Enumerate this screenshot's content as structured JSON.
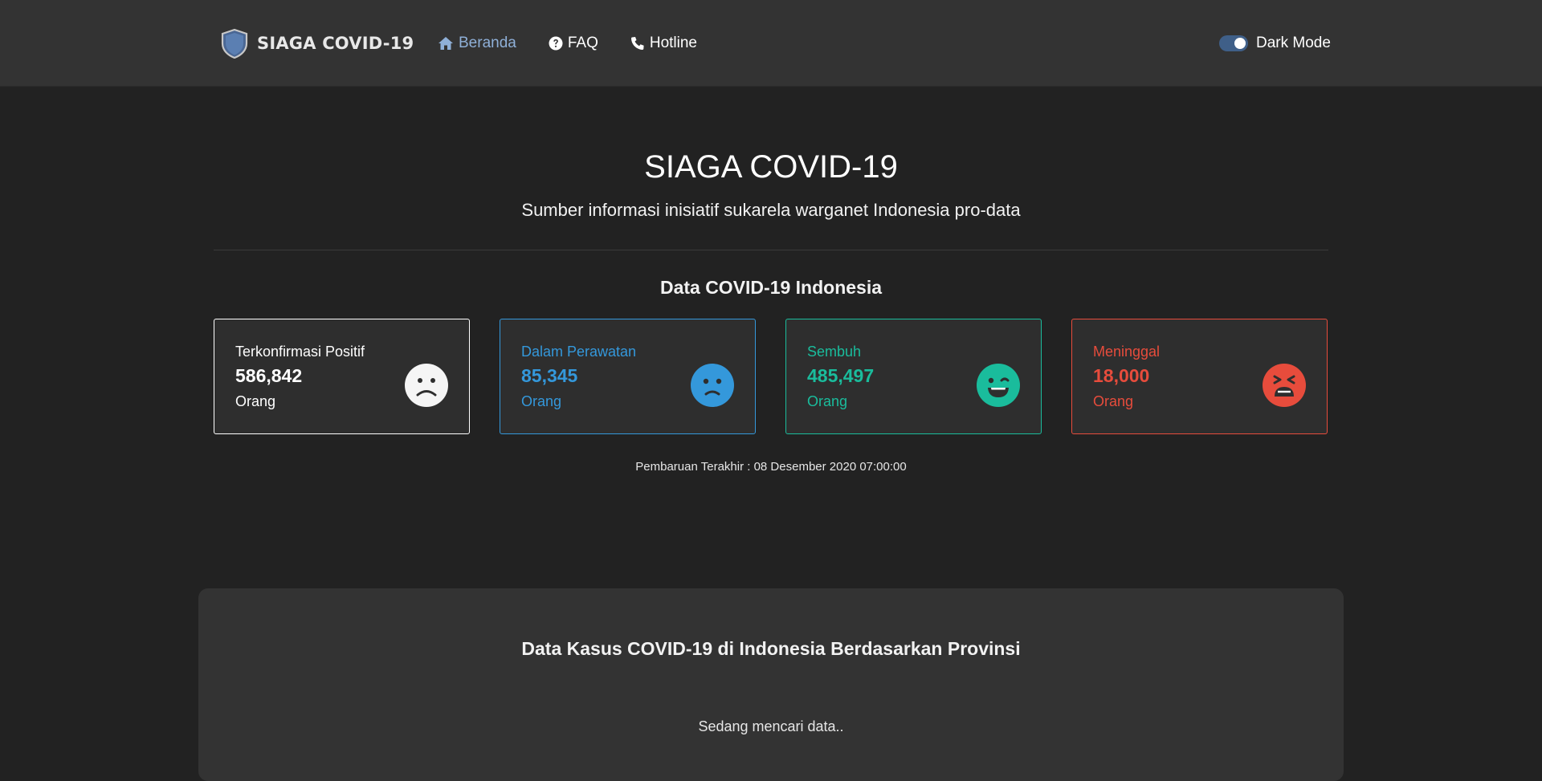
{
  "navbar": {
    "brand": "SIAGA COVID-19",
    "links": [
      {
        "label": "Beranda",
        "icon": "home-icon",
        "active": true
      },
      {
        "label": "FAQ",
        "icon": "question-circle-icon",
        "active": false
      },
      {
        "label": "Hotline",
        "icon": "phone-icon",
        "active": false
      }
    ],
    "dark_mode_label": "Dark Mode",
    "dark_mode_on": true
  },
  "hero": {
    "title": "SIAGA COVID-19",
    "subtitle": "Sumber informasi inisiatif sukarela warganet Indonesia pro-data"
  },
  "stats": {
    "title": "Data COVID-19 Indonesia",
    "cards": [
      {
        "label": "Terkonfirmasi Positif",
        "value": "586,842",
        "unit": "Orang",
        "color": "#ffffff",
        "icon": "frown-face-icon"
      },
      {
        "label": "Dalam Perawatan",
        "value": "85,345",
        "unit": "Orang",
        "color": "#3498db",
        "icon": "sad-face-icon"
      },
      {
        "label": "Sembuh",
        "value": "485,497",
        "unit": "Orang",
        "color": "#1abc9c",
        "icon": "wink-face-icon"
      },
      {
        "label": "Meninggal",
        "value": "18,000",
        "unit": "Orang",
        "color": "#e74c3c",
        "icon": "tired-face-icon"
      }
    ],
    "updated": "Pembaruan Terakhir : 08 Desember 2020 07:00:00"
  },
  "province_panel": {
    "title": "Data Kasus COVID-19 di Indonesia Berdasarkan Provinsi",
    "loading": "Sedang mencari data.."
  },
  "colors": {
    "background": "#222222",
    "navbar": "#333333",
    "accent": "#8fb0d8"
  }
}
